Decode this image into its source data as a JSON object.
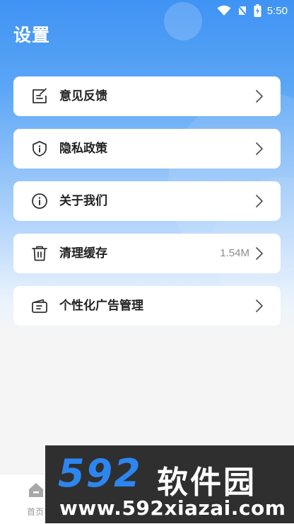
{
  "status_bar": {
    "time": "5:50",
    "icons": [
      "wifi-icon",
      "no-signal-icon",
      "battery-charging-icon"
    ]
  },
  "header": {
    "title": "设置"
  },
  "settings": {
    "items": [
      {
        "label": "意见反馈",
        "icon": "feedback-edit-icon",
        "value": ""
      },
      {
        "label": "隐私政策",
        "icon": "privacy-shield-icon",
        "value": ""
      },
      {
        "label": "关于我们",
        "icon": "info-circle-icon",
        "value": ""
      },
      {
        "label": "清理缓存",
        "icon": "trash-icon",
        "value": "1.54M"
      },
      {
        "label": "个性化广告管理",
        "icon": "ad-card-icon",
        "value": ""
      }
    ]
  },
  "tabbar": {
    "home_label": "首页"
  },
  "watermark": {
    "logo": "592",
    "name": "软件园",
    "url": "www.592xiazai.com"
  },
  "colors": {
    "header_blue": "#3f93f3",
    "card_bg": "#ffffff",
    "text": "#222222",
    "muted": "#8d8d8d"
  }
}
